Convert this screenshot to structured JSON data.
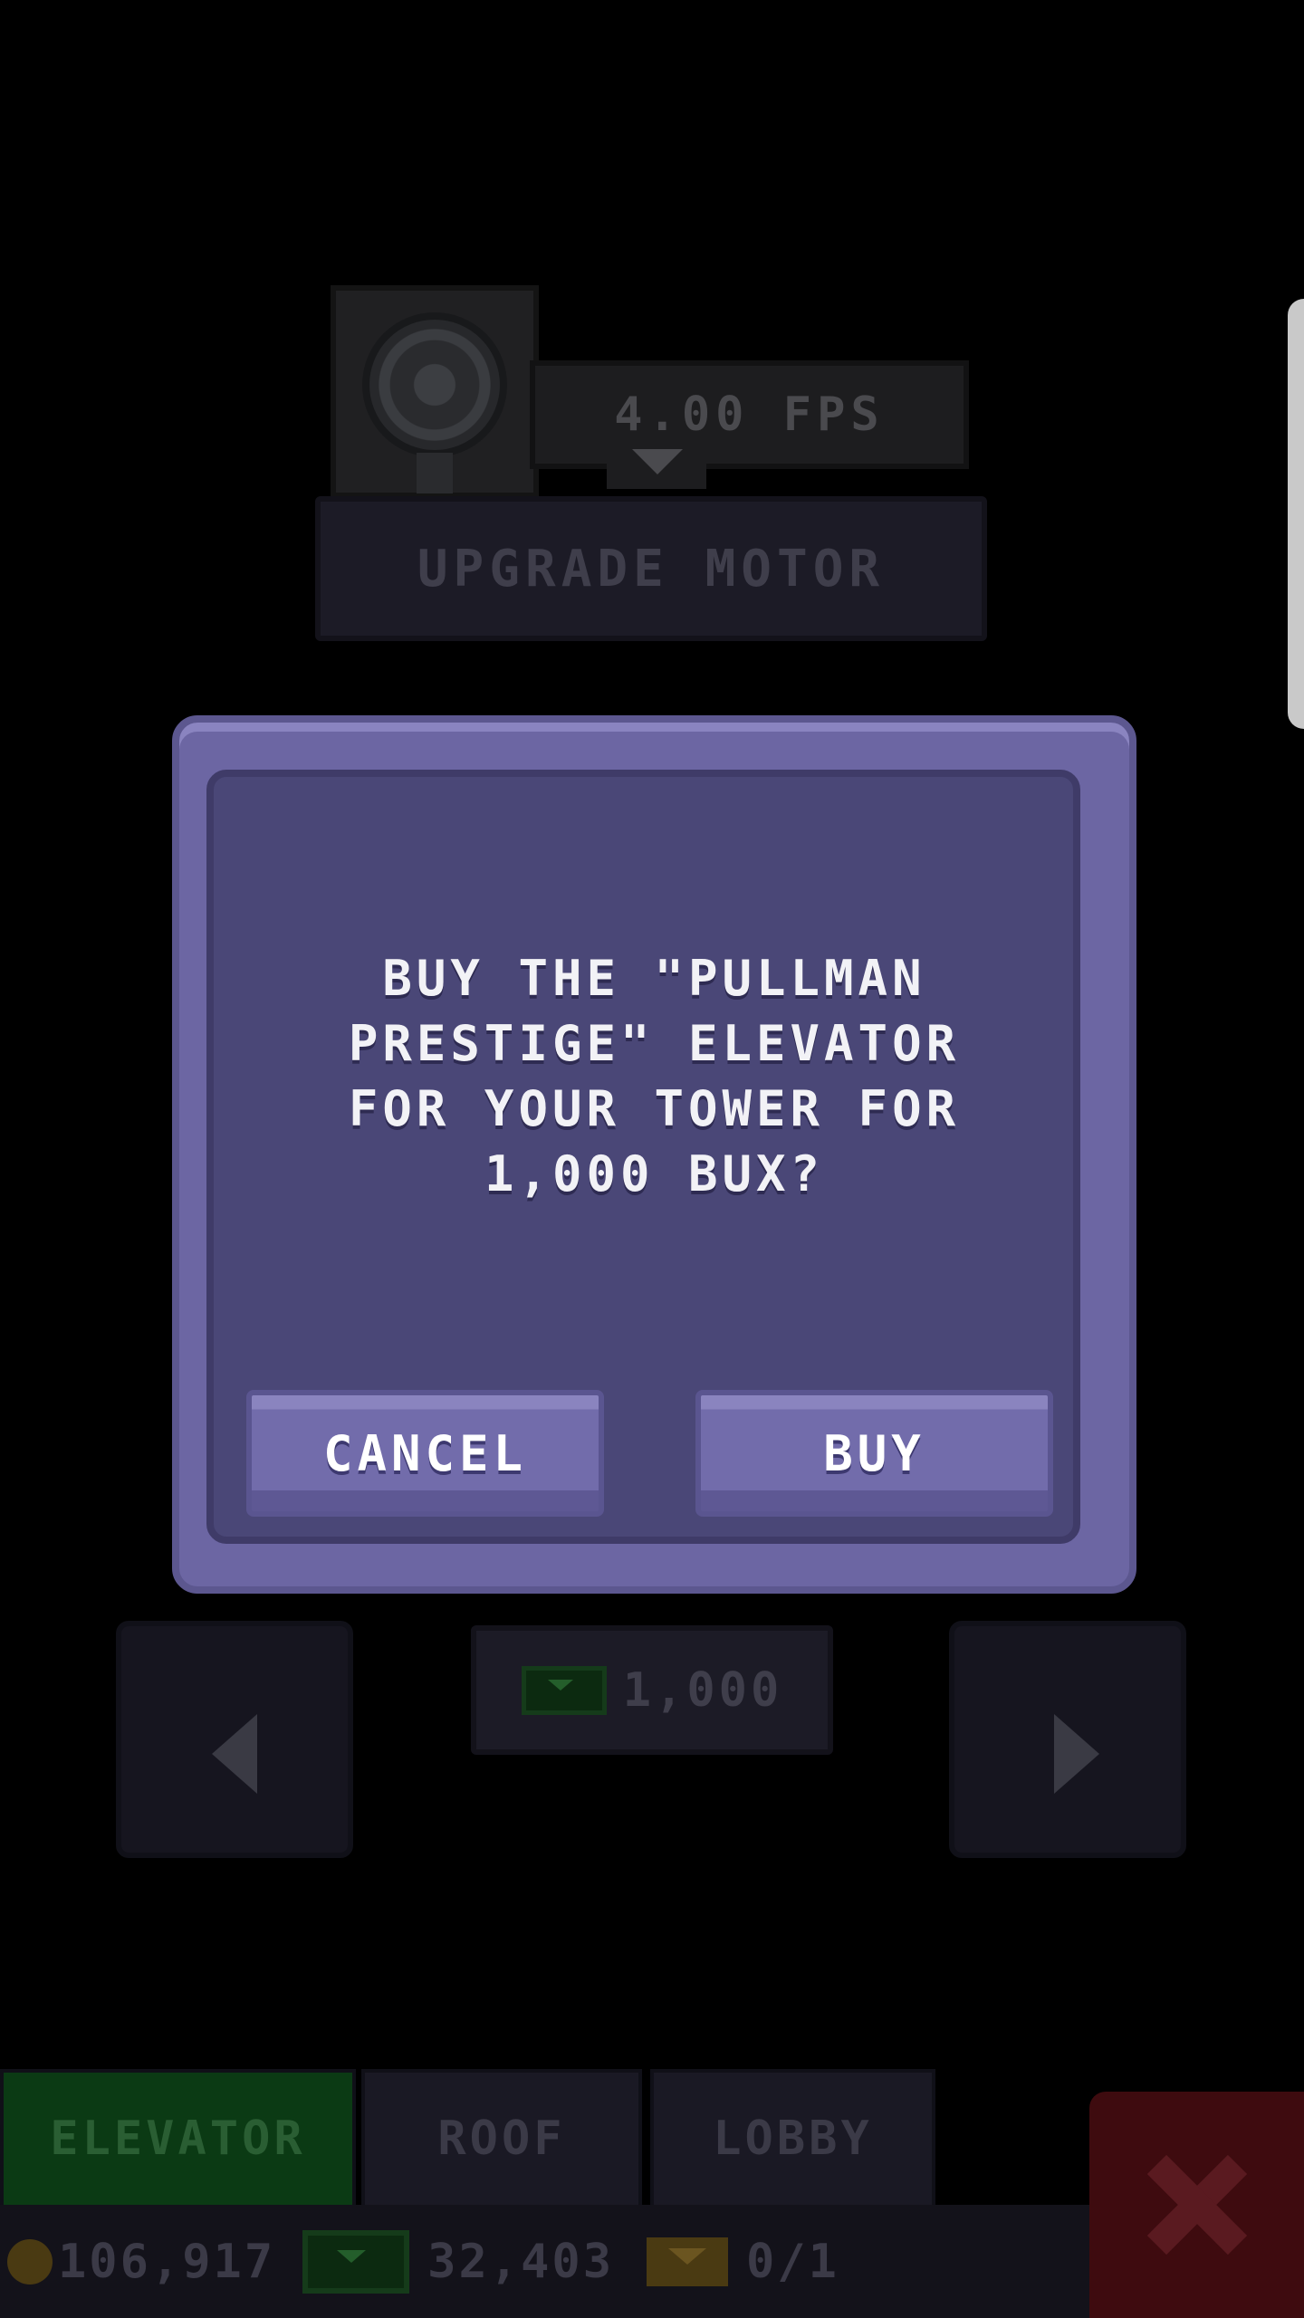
{
  "motor": {
    "fps_label": "4.00 FPS",
    "upgrade_label": "UPGRADE MOTOR"
  },
  "dialog": {
    "message": "BUY THE \"PULLMAN PRESTIGE\" ELEVATOR FOR YOUR TOWER FOR 1,000 BUX?",
    "cancel_label": "CANCEL",
    "buy_label": "BUY"
  },
  "shop": {
    "price": "1,000",
    "price_icon": "bux-icon",
    "prev_icon": "arrow-left-icon",
    "next_icon": "arrow-right-icon"
  },
  "tabs": [
    {
      "label": "ELEVATOR",
      "active": true
    },
    {
      "label": "ROOF",
      "active": false
    },
    {
      "label": "LOBBY",
      "active": false
    }
  ],
  "status": {
    "coins": "106,917",
    "bux": "32,403",
    "tickets": "0/1"
  },
  "colors": {
    "dialog_bg": "#4a4777",
    "dialog_border": "#6c66a3",
    "button": "#726cab",
    "active_tab": "#0b3a14",
    "close": "#3e0b0f"
  }
}
